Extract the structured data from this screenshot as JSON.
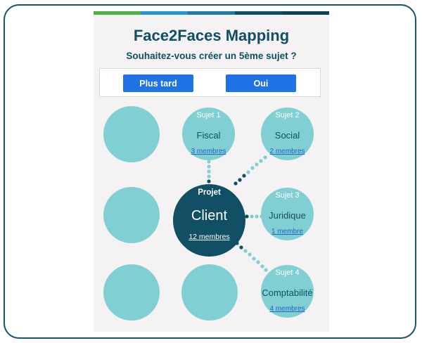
{
  "app": {
    "title": "Face2Faces Mapping",
    "question": "Souhaitez-vous créer un 5ème sujet ?"
  },
  "actions": {
    "later_label": "Plus tard",
    "yes_label": "Oui"
  },
  "colors": {
    "frame": "#17526b",
    "title": "#114e63",
    "button": "#1f73e6",
    "bubble": "#80cfd3",
    "center": "#104f64",
    "link": "#1f63c9",
    "topbar": [
      "#4caf3f",
      "#2196d4",
      "#1b7ca8",
      "#124e63",
      "#0f4255"
    ]
  },
  "project": {
    "label": "Projet",
    "name": "Client",
    "members": "12 membres"
  },
  "subjects": [
    {
      "number": "Sujet 1",
      "name": "Fiscal",
      "members": "3 membres"
    },
    {
      "number": "Sujet 2",
      "name": "Social",
      "members": "2 membres"
    },
    {
      "number": "Sujet 3",
      "name": "Juridique",
      "members": "1 membre"
    },
    {
      "number": "Sujet 4",
      "name": "Comptabilité",
      "members": "4 membres"
    }
  ]
}
